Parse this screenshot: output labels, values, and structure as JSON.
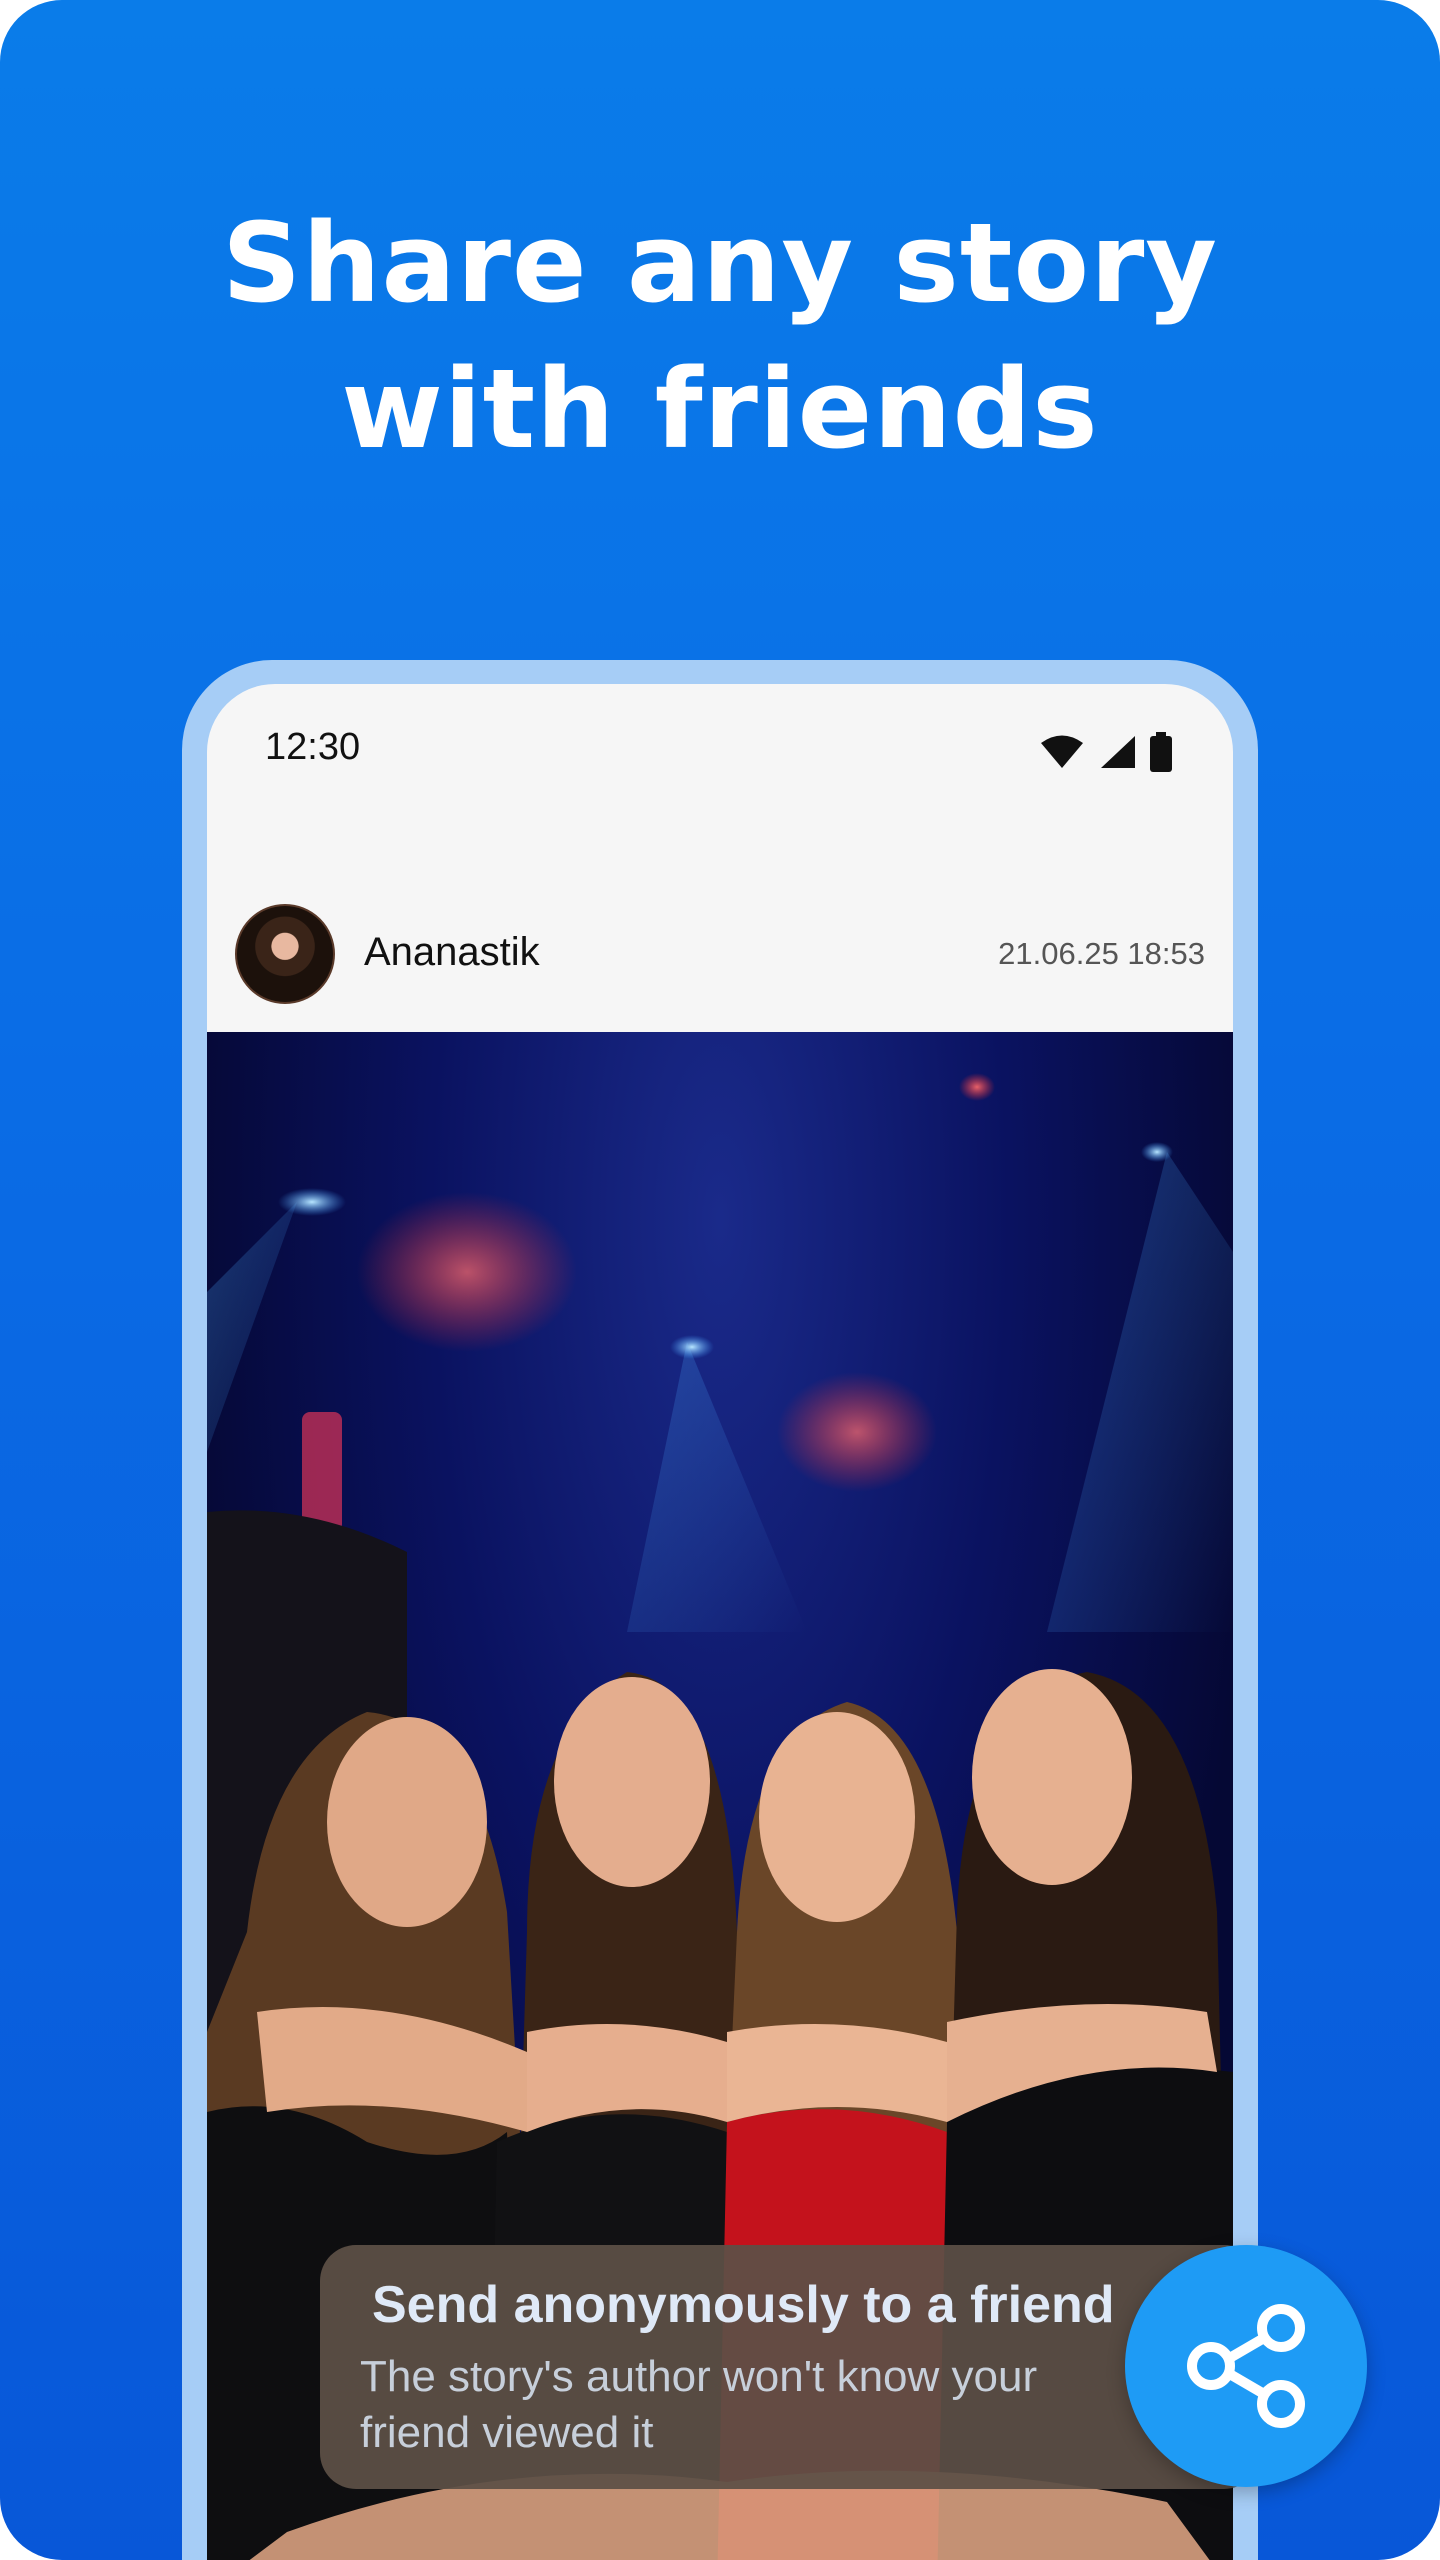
{
  "headline": {
    "line1": "Share any story",
    "line2": "with friends"
  },
  "status_bar": {
    "time": "12:30",
    "icons": [
      "wifi-icon",
      "signal-icon",
      "battery-icon"
    ]
  },
  "post": {
    "author": "Ananastik",
    "date": "21.06.25 18:53"
  },
  "toast": {
    "title": "Send anonymously to a friend",
    "subtitle": "The story's author won't know your friend viewed it"
  },
  "share_button": {
    "icon": "share-icon"
  },
  "colors": {
    "background": "#0a6de6",
    "phone_frame": "#a6cdf6",
    "share_button": "#1e9bf5",
    "toast_bg": "#5c5046"
  }
}
